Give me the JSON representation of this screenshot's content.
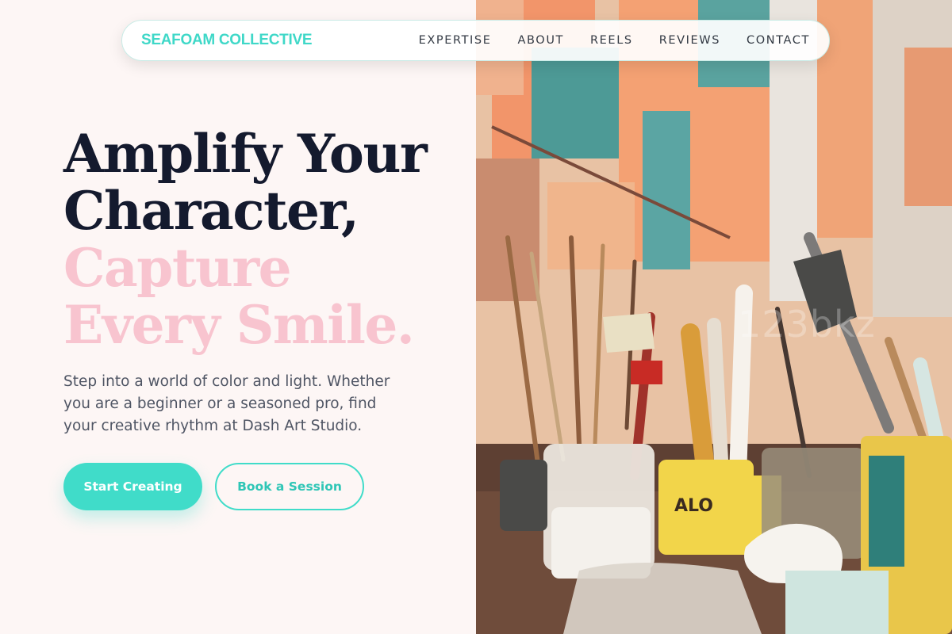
{
  "nav": {
    "brand": "SEAFOAM COLLECTIVE",
    "links": [
      "EXPERTISE",
      "ABOUT",
      "REELS",
      "REVIEWS",
      "CONTACT"
    ]
  },
  "hero": {
    "title_line1": "Amplify Your",
    "title_line2": "Character,",
    "title_line3": "Capture",
    "title_line4": "Every Smile.",
    "subtitle": "Step into a world of color and light. Whether you are a beginner or a seasoned pro, find your creative rhythm at Dash Art Studio.",
    "primary_button": "Start Creating",
    "secondary_button": "Book a Session"
  },
  "image": {
    "watermark": "123bkz"
  },
  "colors": {
    "accent": "#40dcc9",
    "title_dark": "#141a2e",
    "title_pink": "#f8c4cf",
    "background": "#fdf6f5"
  }
}
